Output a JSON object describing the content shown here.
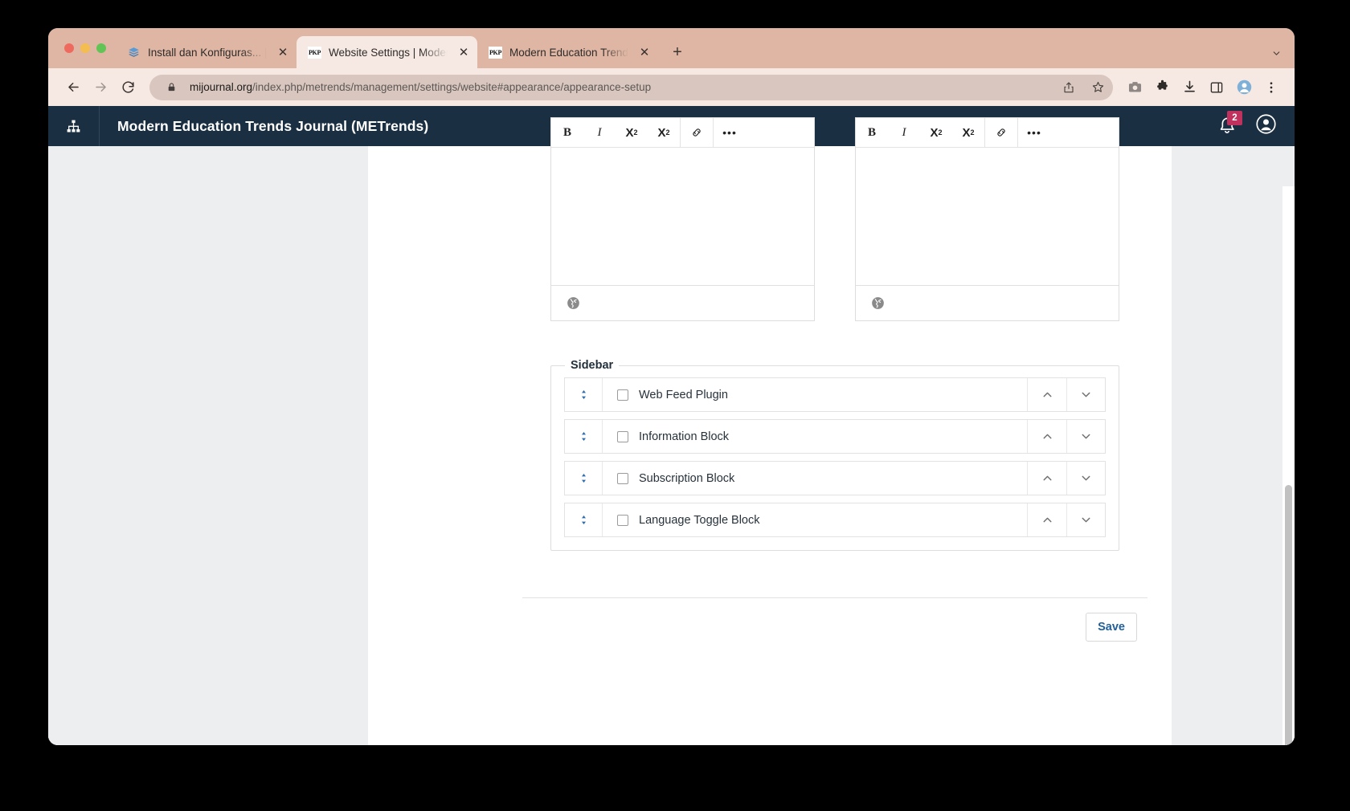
{
  "browser": {
    "tabs": [
      {
        "title": "Install dan Konfiguras... | Book",
        "favicon": "books-icon",
        "active": false,
        "close_label": "✕"
      },
      {
        "title": "Website Settings | Modern Ed",
        "favicon": "pkp-icon",
        "favicon_text": "PKP",
        "active": true,
        "close_label": "✕"
      },
      {
        "title": "Modern Education Trends Jou",
        "favicon": "pkp-icon",
        "favicon_text": "PKP",
        "active": false,
        "close_label": "✕"
      }
    ],
    "new_tab_label": "+",
    "toolbar": {
      "back_label": "←",
      "forward_label": "→",
      "reload_label": "↻",
      "url_secure": "mijournal.org",
      "url_path": "/index.php/metrends/management/settings/website#appearance/appearance-setup",
      "icons": [
        "lock-icon",
        "share-icon",
        "bookmark-star-icon",
        "screenshot-camera-icon",
        "extensions-puzzle-icon",
        "downloads-icon",
        "side-panel-icon",
        "profile-avatar-icon",
        "chrome-menu-icon"
      ]
    }
  },
  "app_header": {
    "logo_icon": "sitemap-icon",
    "title": "Modern Education Trends Journal (METrends)",
    "notifications_icon": "bell-icon",
    "notifications_count": "2",
    "account_icon": "user-avatar-icon",
    "badge_color": "#c0315e",
    "bar_color": "#1b2f42"
  },
  "editors": [
    {
      "name": "rich-text-editor-left",
      "toolbar": {
        "bold": "B",
        "italic": "I",
        "superscript": "X",
        "superscript_sup": "2",
        "subscript": "X",
        "subscript_sub": "2",
        "link": "link-icon",
        "more": "•••"
      },
      "content": "",
      "footer_icon": "globe-language-icon"
    },
    {
      "name": "rich-text-editor-right",
      "toolbar": {
        "bold": "B",
        "italic": "I",
        "superscript": "X",
        "superscript_sup": "2",
        "subscript": "X",
        "subscript_sub": "2",
        "link": "link-icon",
        "more": "•••"
      },
      "content": "",
      "footer_icon": "globe-language-icon"
    }
  ],
  "sidebar_fieldset": {
    "legend": "Sidebar",
    "rows": [
      {
        "label": "Web Feed Plugin",
        "checked": false
      },
      {
        "label": "Information Block",
        "checked": false
      },
      {
        "label": "Subscription Block",
        "checked": false
      },
      {
        "label": "Language Toggle Block",
        "checked": false
      }
    ],
    "move_up_label": "move-up",
    "move_down_label": "move-down",
    "drag_label": "drag-handle"
  },
  "form_footer": {
    "save_label": "Save",
    "save_color": "#22609c"
  }
}
